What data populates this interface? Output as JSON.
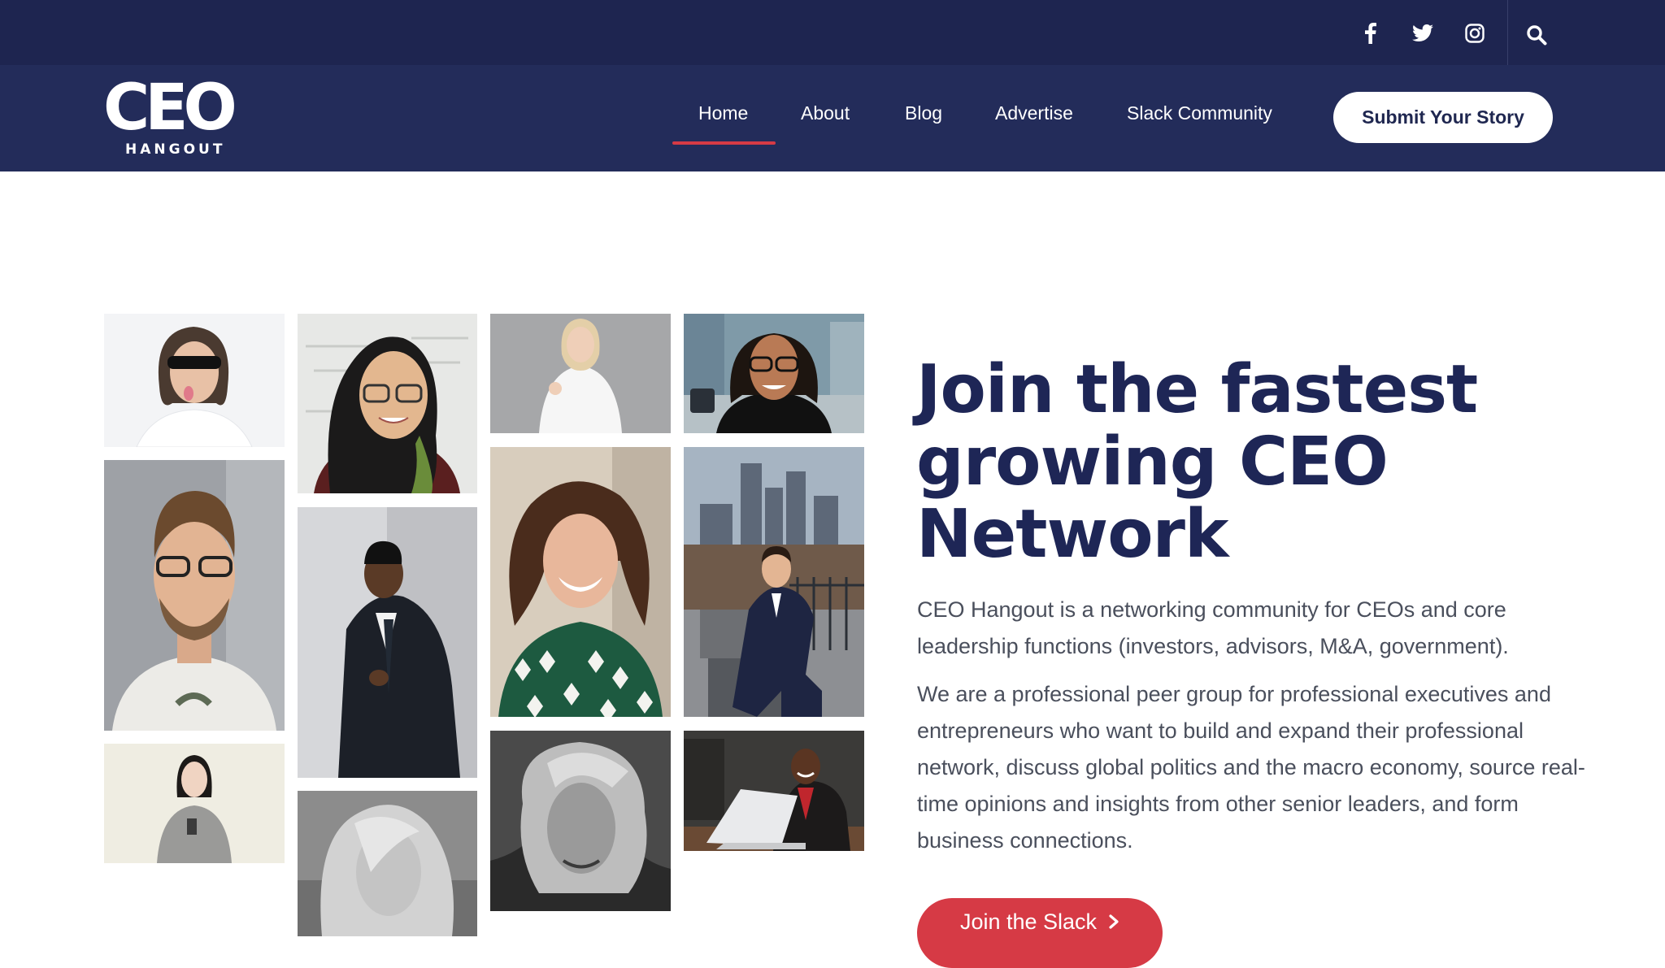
{
  "social": {
    "facebook_icon": "facebook-icon",
    "twitter_icon": "twitter-icon",
    "instagram_icon": "instagram-icon",
    "search_icon": "search-icon"
  },
  "logo": {
    "word": "CEO",
    "sub": "HANGOUT"
  },
  "nav": {
    "items": [
      "Home",
      "About",
      "Blog",
      "Advertise",
      "Slack Community"
    ],
    "active": "Home"
  },
  "submit_label": "Submit Your Story",
  "hero": {
    "title_line1": "Join the fastest",
    "title_line2": "growing CEO",
    "title_line3": "Network",
    "paragraph1": "CEO Hangout is a networking community for CEOs and core leadership functions (investors, advisors, M&A, government).",
    "paragraph2": "We are a professional peer group for professional executives and entrepreneurs who want to build and expand their professional network, discuss global politics and the macro economy, source real-time opinions and insights from other senior leaders, and form business connections.",
    "cta_label": "Join the Slack"
  },
  "colors": {
    "topbar": "#1e2550",
    "navbar": "#232c5a",
    "accent": "#d63a45",
    "heading": "#1e2656",
    "body_text": "#4a4f5c"
  }
}
